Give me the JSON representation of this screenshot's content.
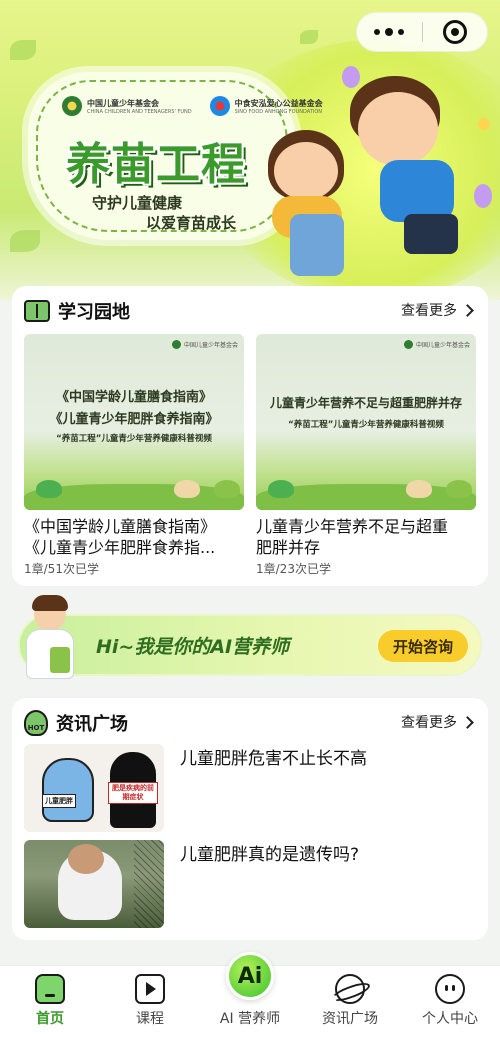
{
  "hero": {
    "org1_cn": "中国儿童少年基金会",
    "org1_en": "CHINA CHILDREN AND TEENAGERS' FUND",
    "org2_cn": "中食安泓爱心公益基金会",
    "org2_en": "SINO FOOD ANHONG FOUNDATION",
    "title": "养苗工程",
    "slogan_line1": "守护儿童健康",
    "slogan_line2": "以爱育苗成长"
  },
  "study": {
    "title": "学习园地",
    "more_label": "查看更多",
    "courses": [
      {
        "thumb_org": "中国儿童少年基金会",
        "thumb_line1": "《中国学龄儿童膳食指南》",
        "thumb_line2": "《儿童青少年肥胖食养指南》",
        "thumb_sub": "“养苗工程”儿童青少年营养健康科普视频",
        "name_line1": "《中国学龄儿童膳食指南》",
        "name_line2": "《儿童青少年肥胖食养指...",
        "meta": "1章/51次已学"
      },
      {
        "thumb_org": "中国儿童少年基金会",
        "thumb_line1": "儿童青少年营养不足与超重肥胖并存",
        "thumb_sub": "“养苗工程”儿童青少年营养健康科普视频",
        "name_line1": "儿童青少年营养不足与超重",
        "name_line2": "肥胖并存",
        "meta": "1章/23次已学"
      }
    ]
  },
  "ai_banner": {
    "text": "Hi~我是你的AI营养师",
    "button": "开始咨询"
  },
  "news": {
    "title": "资讯广场",
    "more_label": "查看更多",
    "hot_badge": "HOT",
    "items": [
      {
        "title": "儿童肥胖危害不止长不高",
        "thumb_tag1": "儿童肥胖",
        "thumb_tag2": "肥是疾病的前期症状"
      },
      {
        "title": "儿童肥胖真的是遗传吗?"
      }
    ]
  },
  "tabbar": {
    "items": [
      {
        "label": "首页",
        "active": true
      },
      {
        "label": "课程"
      },
      {
        "label": "AI 营养师",
        "fab": "Ai"
      },
      {
        "label": "资讯广场"
      },
      {
        "label": "个人中心"
      }
    ],
    "accent": "#3b9a2a"
  },
  "colors": {
    "brand_green": "#3a9a2a",
    "button_yellow": "#f7cc2b",
    "page_bg": "#f2f4f1"
  }
}
